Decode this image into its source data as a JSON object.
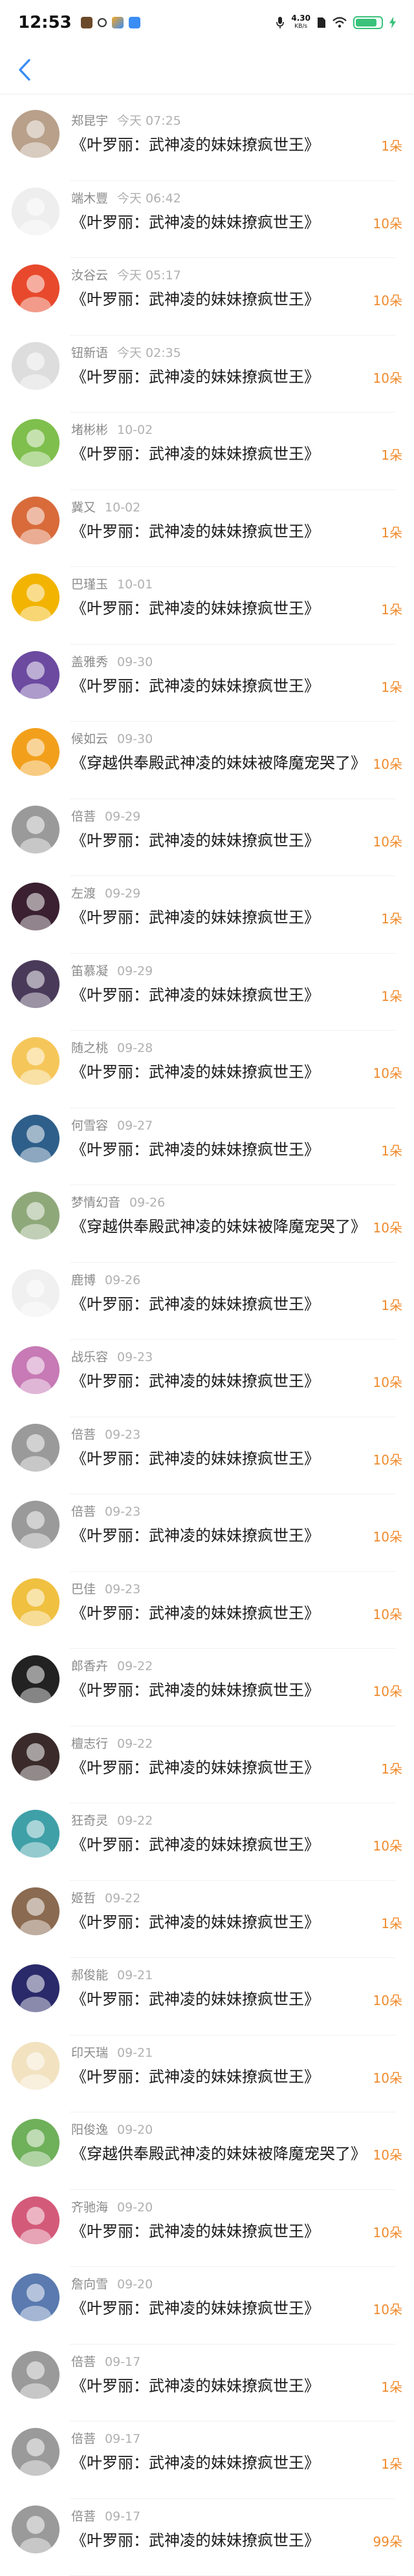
{
  "status_bar": {
    "time": "12:53",
    "speed_value": "4.30",
    "speed_unit": "KB/s",
    "battery": "",
    "battery_level": 0.85,
    "colors": {
      "battery": "#3ac27a"
    }
  },
  "nav": {
    "back_icon": "chevron-left-icon",
    "accent": "#3a8df5"
  },
  "colors": {
    "count": "#f08a2c",
    "name": "#8a8a8a",
    "time": "#b0b0b0"
  },
  "items": [
    {
      "name": "郑昆宇",
      "time": "今天 07:25",
      "title": "《叶罗丽：武神凌的妹妹撩疯世王》",
      "count": "1朵",
      "avatar": "#b8a08a"
    },
    {
      "name": "端木豐",
      "time": "今天 06:42",
      "title": "《叶罗丽：武神凌的妹妹撩疯世王》",
      "count": "10朵",
      "avatar": "#eeeeee"
    },
    {
      "name": "汝谷云",
      "time": "今天 05:17",
      "title": "《叶罗丽：武神凌的妹妹撩疯世王》",
      "count": "10朵",
      "avatar": "#e8492c"
    },
    {
      "name": "钮新语",
      "time": "今天 02:35",
      "title": "《叶罗丽：武神凌的妹妹撩疯世王》",
      "count": "10朵",
      "avatar": "#dddddd"
    },
    {
      "name": "堵彬彬",
      "time": "10-02",
      "title": "《叶罗丽：武神凌的妹妹撩疯世王》",
      "count": "1朵",
      "avatar": "#7fbf4d"
    },
    {
      "name": "冀又",
      "time": "10-02",
      "title": "《叶罗丽：武神凌的妹妹撩疯世王》",
      "count": "1朵",
      "avatar": "#d96b3b"
    },
    {
      "name": "巴瑾玉",
      "time": "10-01",
      "title": "《叶罗丽：武神凌的妹妹撩疯世王》",
      "count": "1朵",
      "avatar": "#f2b400"
    },
    {
      "name": "盖雅秀",
      "time": "09-30",
      "title": "《叶罗丽：武神凌的妹妹撩疯世王》",
      "count": "1朵",
      "avatar": "#6b4aa0"
    },
    {
      "name": "候如云",
      "time": "09-30",
      "title": "《穿越供奉殿武神凌的妹妹被降魔宠哭了》",
      "count": "10朵",
      "avatar": "#f2a01c"
    },
    {
      "name": "倍菩",
      "time": "09-29",
      "title": "《叶罗丽：武神凌的妹妹撩疯世王》",
      "count": "10朵",
      "avatar": "#9a9a9a"
    },
    {
      "name": "左渡",
      "time": "09-29",
      "title": "《叶罗丽：武神凌的妹妹撩疯世王》",
      "count": "1朵",
      "avatar": "#3a2030"
    },
    {
      "name": "笛慕凝",
      "time": "09-29",
      "title": "《叶罗丽：武神凌的妹妹撩疯世王》",
      "count": "1朵",
      "avatar": "#4a3a5a"
    },
    {
      "name": "随之桃",
      "time": "09-28",
      "title": "《叶罗丽：武神凌的妹妹撩疯世王》",
      "count": "10朵",
      "avatar": "#f5c75a"
    },
    {
      "name": "何雪容",
      "time": "09-27",
      "title": "《叶罗丽：武神凌的妹妹撩疯世王》",
      "count": "1朵",
      "avatar": "#2e5f8a"
    },
    {
      "name": "梦情幻音",
      "time": "09-26",
      "title": "《穿越供奉殿武神凌的妹妹被降魔宠哭了》",
      "count": "10朵",
      "avatar": "#8fa87a"
    },
    {
      "name": "鹿博",
      "time": "09-26",
      "title": "《叶罗丽：武神凌的妹妹撩疯世王》",
      "count": "1朵",
      "avatar": "#f0f0f0"
    },
    {
      "name": "战乐容",
      "time": "09-23",
      "title": "《叶罗丽：武神凌的妹妹撩疯世王》",
      "count": "10朵",
      "avatar": "#c77ab5"
    },
    {
      "name": "倍菩",
      "time": "09-23",
      "title": "《叶罗丽：武神凌的妹妹撩疯世王》",
      "count": "10朵",
      "avatar": "#9a9a9a"
    },
    {
      "name": "倍菩",
      "time": "09-23",
      "title": "《叶罗丽：武神凌的妹妹撩疯世王》",
      "count": "10朵",
      "avatar": "#9a9a9a"
    },
    {
      "name": "巴佳",
      "time": "09-23",
      "title": "《叶罗丽：武神凌的妹妹撩疯世王》",
      "count": "10朵",
      "avatar": "#f0c040"
    },
    {
      "name": "郎香卉",
      "time": "09-22",
      "title": "《叶罗丽：武神凌的妹妹撩疯世王》",
      "count": "10朵",
      "avatar": "#222222"
    },
    {
      "name": "檀志行",
      "time": "09-22",
      "title": "《叶罗丽：武神凌的妹妹撩疯世王》",
      "count": "1朵",
      "avatar": "#3a2a2a"
    },
    {
      "name": "狂奇灵",
      "time": "09-22",
      "title": "《叶罗丽：武神凌的妹妹撩疯世王》",
      "count": "10朵",
      "avatar": "#3fa0a8"
    },
    {
      "name": "姬哲",
      "time": "09-22",
      "title": "《叶罗丽：武神凌的妹妹撩疯世王》",
      "count": "1朵",
      "avatar": "#8a6a50"
    },
    {
      "name": "郝俊能",
      "time": "09-21",
      "title": "《叶罗丽：武神凌的妹妹撩疯世王》",
      "count": "10朵",
      "avatar": "#2a2a6a"
    },
    {
      "name": "印天瑞",
      "time": "09-21",
      "title": "《叶罗丽：武神凌的妹妹撩疯世王》",
      "count": "10朵",
      "avatar": "#f2e2c0"
    },
    {
      "name": "阳俊逸",
      "time": "09-20",
      "title": "《穿越供奉殿武神凌的妹妹被降魔宠哭了》",
      "count": "10朵",
      "avatar": "#6fb05a"
    },
    {
      "name": "齐驰海",
      "time": "09-20",
      "title": "《叶罗丽：武神凌的妹妹撩疯世王》",
      "count": "10朵",
      "avatar": "#d45a7a"
    },
    {
      "name": "詹向雪",
      "time": "09-20",
      "title": "《叶罗丽：武神凌的妹妹撩疯世王》",
      "count": "10朵",
      "avatar": "#5a7ab0"
    },
    {
      "name": "倍菩",
      "time": "09-17",
      "title": "《叶罗丽：武神凌的妹妹撩疯世王》",
      "count": "1朵",
      "avatar": "#9a9a9a"
    },
    {
      "name": "倍菩",
      "time": "09-17",
      "title": "《叶罗丽：武神凌的妹妹撩疯世王》",
      "count": "1朵",
      "avatar": "#9a9a9a"
    },
    {
      "name": "倍菩",
      "time": "09-17",
      "title": "《叶罗丽：武神凌的妹妹撩疯世王》",
      "count": "99朵",
      "avatar": "#9a9a9a"
    }
  ]
}
